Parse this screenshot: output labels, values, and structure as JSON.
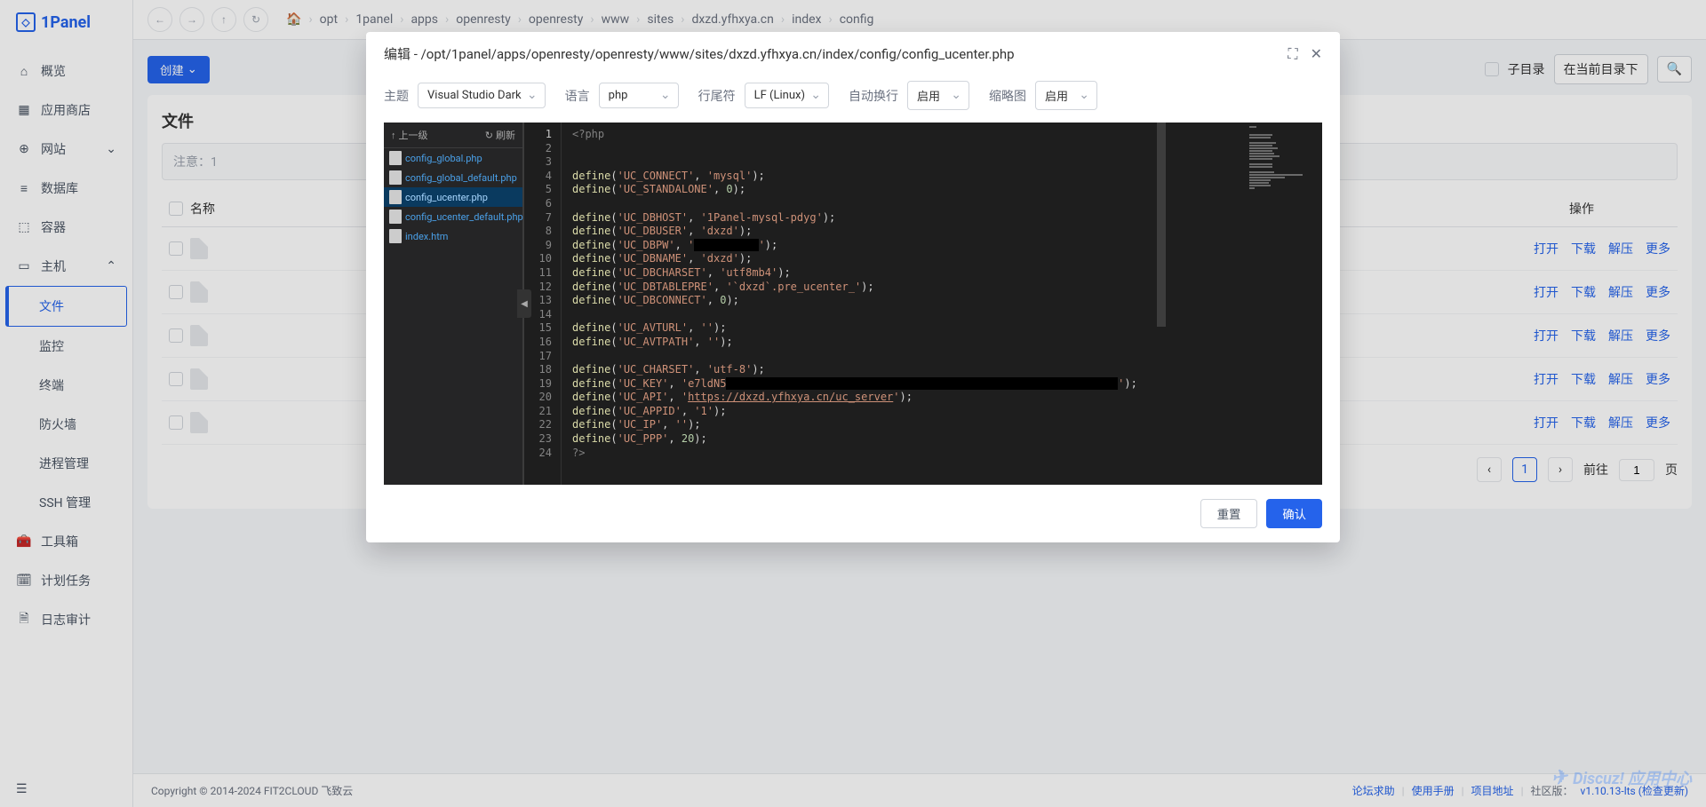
{
  "brand": "1Panel",
  "nav": {
    "overview": "概览",
    "appstore": "应用商店",
    "website": "网站",
    "database": "数据库",
    "container": "容器",
    "host": "主机",
    "sub_file": "文件",
    "sub_monitor": "监控",
    "sub_terminal": "终端",
    "sub_firewall": "防火墙",
    "sub_process": "进程管理",
    "sub_ssh": "SSH 管理",
    "toolbox": "工具箱",
    "cron": "计划任务",
    "audit": "日志审计"
  },
  "breadcrumb": [
    "opt",
    "1panel",
    "apps",
    "openresty",
    "openresty",
    "www",
    "sites",
    "dxzd.yfhxya.cn",
    "index",
    "config"
  ],
  "toolbar": {
    "create": "创建",
    "sub_dir": "子目录",
    "search_placeholder": "在当前目录下",
    "search_icon_label": "搜"
  },
  "panel": {
    "title": "文件",
    "note": "注意：1",
    "th_name": "名称",
    "th_ops": "操作",
    "op_open": "打开",
    "op_download": "下载",
    "op_extract": "解压",
    "op_more": "更多"
  },
  "pagination": {
    "current": "1",
    "goto": "前往",
    "goto_val": "1",
    "page_suffix": "页"
  },
  "footer": {
    "copyright": "Copyright © 2014-2024 FIT2CLOUD 飞致云",
    "link_forum": "论坛求助",
    "link_manual": "使用手册",
    "link_project": "项目地址",
    "link_community": "社区版：",
    "version": "v1.10.13-lts (检查更新)"
  },
  "watermark": "Discuz! 应用中心",
  "modal": {
    "title_prefix": "编辑 - ",
    "path": "/opt/1panel/apps/openresty/openresty/www/sites/dxzd.yfhxya.cn/index/config/config_ucenter.php",
    "controls": {
      "theme_label": "主题",
      "theme_value": "Visual Studio Dark",
      "lang_label": "语言",
      "lang_value": "php",
      "eol_label": "行尾符",
      "eol_value": "LF (Linux)",
      "wrap_label": "自动换行",
      "wrap_value": "启用",
      "minimap_label": "缩略图",
      "minimap_value": "启用"
    },
    "tree": {
      "up": "上一级",
      "refresh": "刷新",
      "files": [
        "config_global.php",
        "config_global_default.php",
        "config_ucenter.php",
        "config_ucenter_default.php",
        "index.htm"
      ],
      "active_index": 2
    },
    "code_totals": 24,
    "footer_reset": "重置",
    "footer_confirm": "确认"
  },
  "code": {
    "l1": "<?php",
    "l4_str1": "'UC_CONNECT'",
    "l4_str2": "'mysql'",
    "l5_str1": "'UC_STANDALONE'",
    "l5_num": "0",
    "l7_str1": "'UC_DBHOST'",
    "l7_str2": "'1Panel-mysql-pdyg'",
    "l8_str1": "'UC_DBUSER'",
    "l8_str2": "'dxzd'",
    "l9_str1": "'UC_DBPW'",
    "l9_str2": "'",
    "l10_str1": "'UC_DBNAME'",
    "l10_str2": "'dxzd'",
    "l11_str1": "'UC_DBCHARSET'",
    "l11_str2": "'utf8mb4'",
    "l12_str1": "'UC_DBTABLEPRE'",
    "l12_str2": "'`dxzd`.pre_ucenter_'",
    "l13_str1": "'UC_DBCONNECT'",
    "l13_num": "0",
    "l15_str1": "'UC_AVTURL'",
    "l15_str2": "''",
    "l16_str1": "'UC_AVTPATH'",
    "l16_str2": "''",
    "l18_str1": "'UC_CHARSET'",
    "l18_str2": "'utf-8'",
    "l19_str1": "'UC_KEY'",
    "l19_str2": "'e7ldN5",
    "l20_str1": "'UC_API'",
    "l20_str2a": "'",
    "l20_url": "https://dxzd.yfhxya.cn/uc_server",
    "l20_str2b": "'",
    "l21_str1": "'UC_APPID'",
    "l21_str2": "'1'",
    "l22_str1": "'UC_IP'",
    "l22_str2": "''",
    "l23_str1": "'UC_PPP'",
    "l23_num": "20",
    "l24": "?>",
    "fn": "define"
  }
}
